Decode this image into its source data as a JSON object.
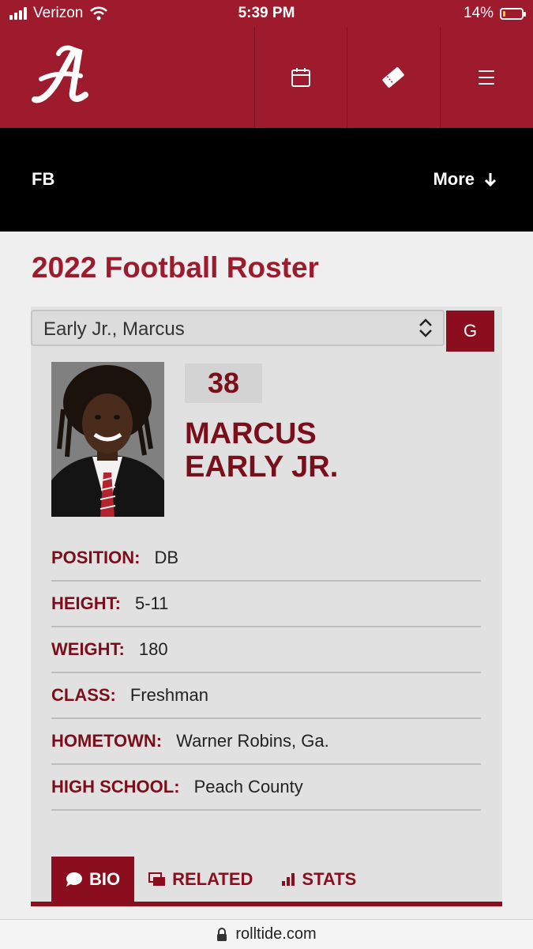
{
  "status_bar": {
    "carrier": "Verizon",
    "time": "5:39 PM",
    "battery": "14%",
    "battery_level": 0.14
  },
  "header": {
    "logo_letter": "A",
    "icons": [
      "calendar-icon",
      "ticket-icon",
      "menu-icon"
    ]
  },
  "subnav": {
    "section": "FB",
    "more_label": "More"
  },
  "page": {
    "title": "2022 Football Roster"
  },
  "player_select": {
    "value": "Early Jr., Marcus",
    "go_label": "G"
  },
  "player": {
    "number": "38",
    "first_name": "MARCUS",
    "last_name": "EARLY JR."
  },
  "info": [
    {
      "label": "POSITION:",
      "value": "DB"
    },
    {
      "label": "HEIGHT:",
      "value": "5-11"
    },
    {
      "label": "WEIGHT:",
      "value": "180"
    },
    {
      "label": "CLASS:",
      "value": "Freshman"
    },
    {
      "label": "HOMETOWN:",
      "value": "Warner Robins, Ga."
    },
    {
      "label": "HIGH SCHOOL:",
      "value": "Peach County"
    }
  ],
  "tabs": [
    {
      "label": "BIO",
      "icon": "chat-bubble-icon",
      "active": true
    },
    {
      "label": "RELATED",
      "icon": "gallery-icon",
      "active": false
    },
    {
      "label": "STATS",
      "icon": "bar-chart-icon",
      "active": false
    }
  ],
  "url_bar": {
    "domain": "rolltide.com"
  },
  "colors": {
    "crimson": "#9d1b2d",
    "dark_crimson": "#8b0e1e",
    "name_red": "#7a0f1c"
  }
}
